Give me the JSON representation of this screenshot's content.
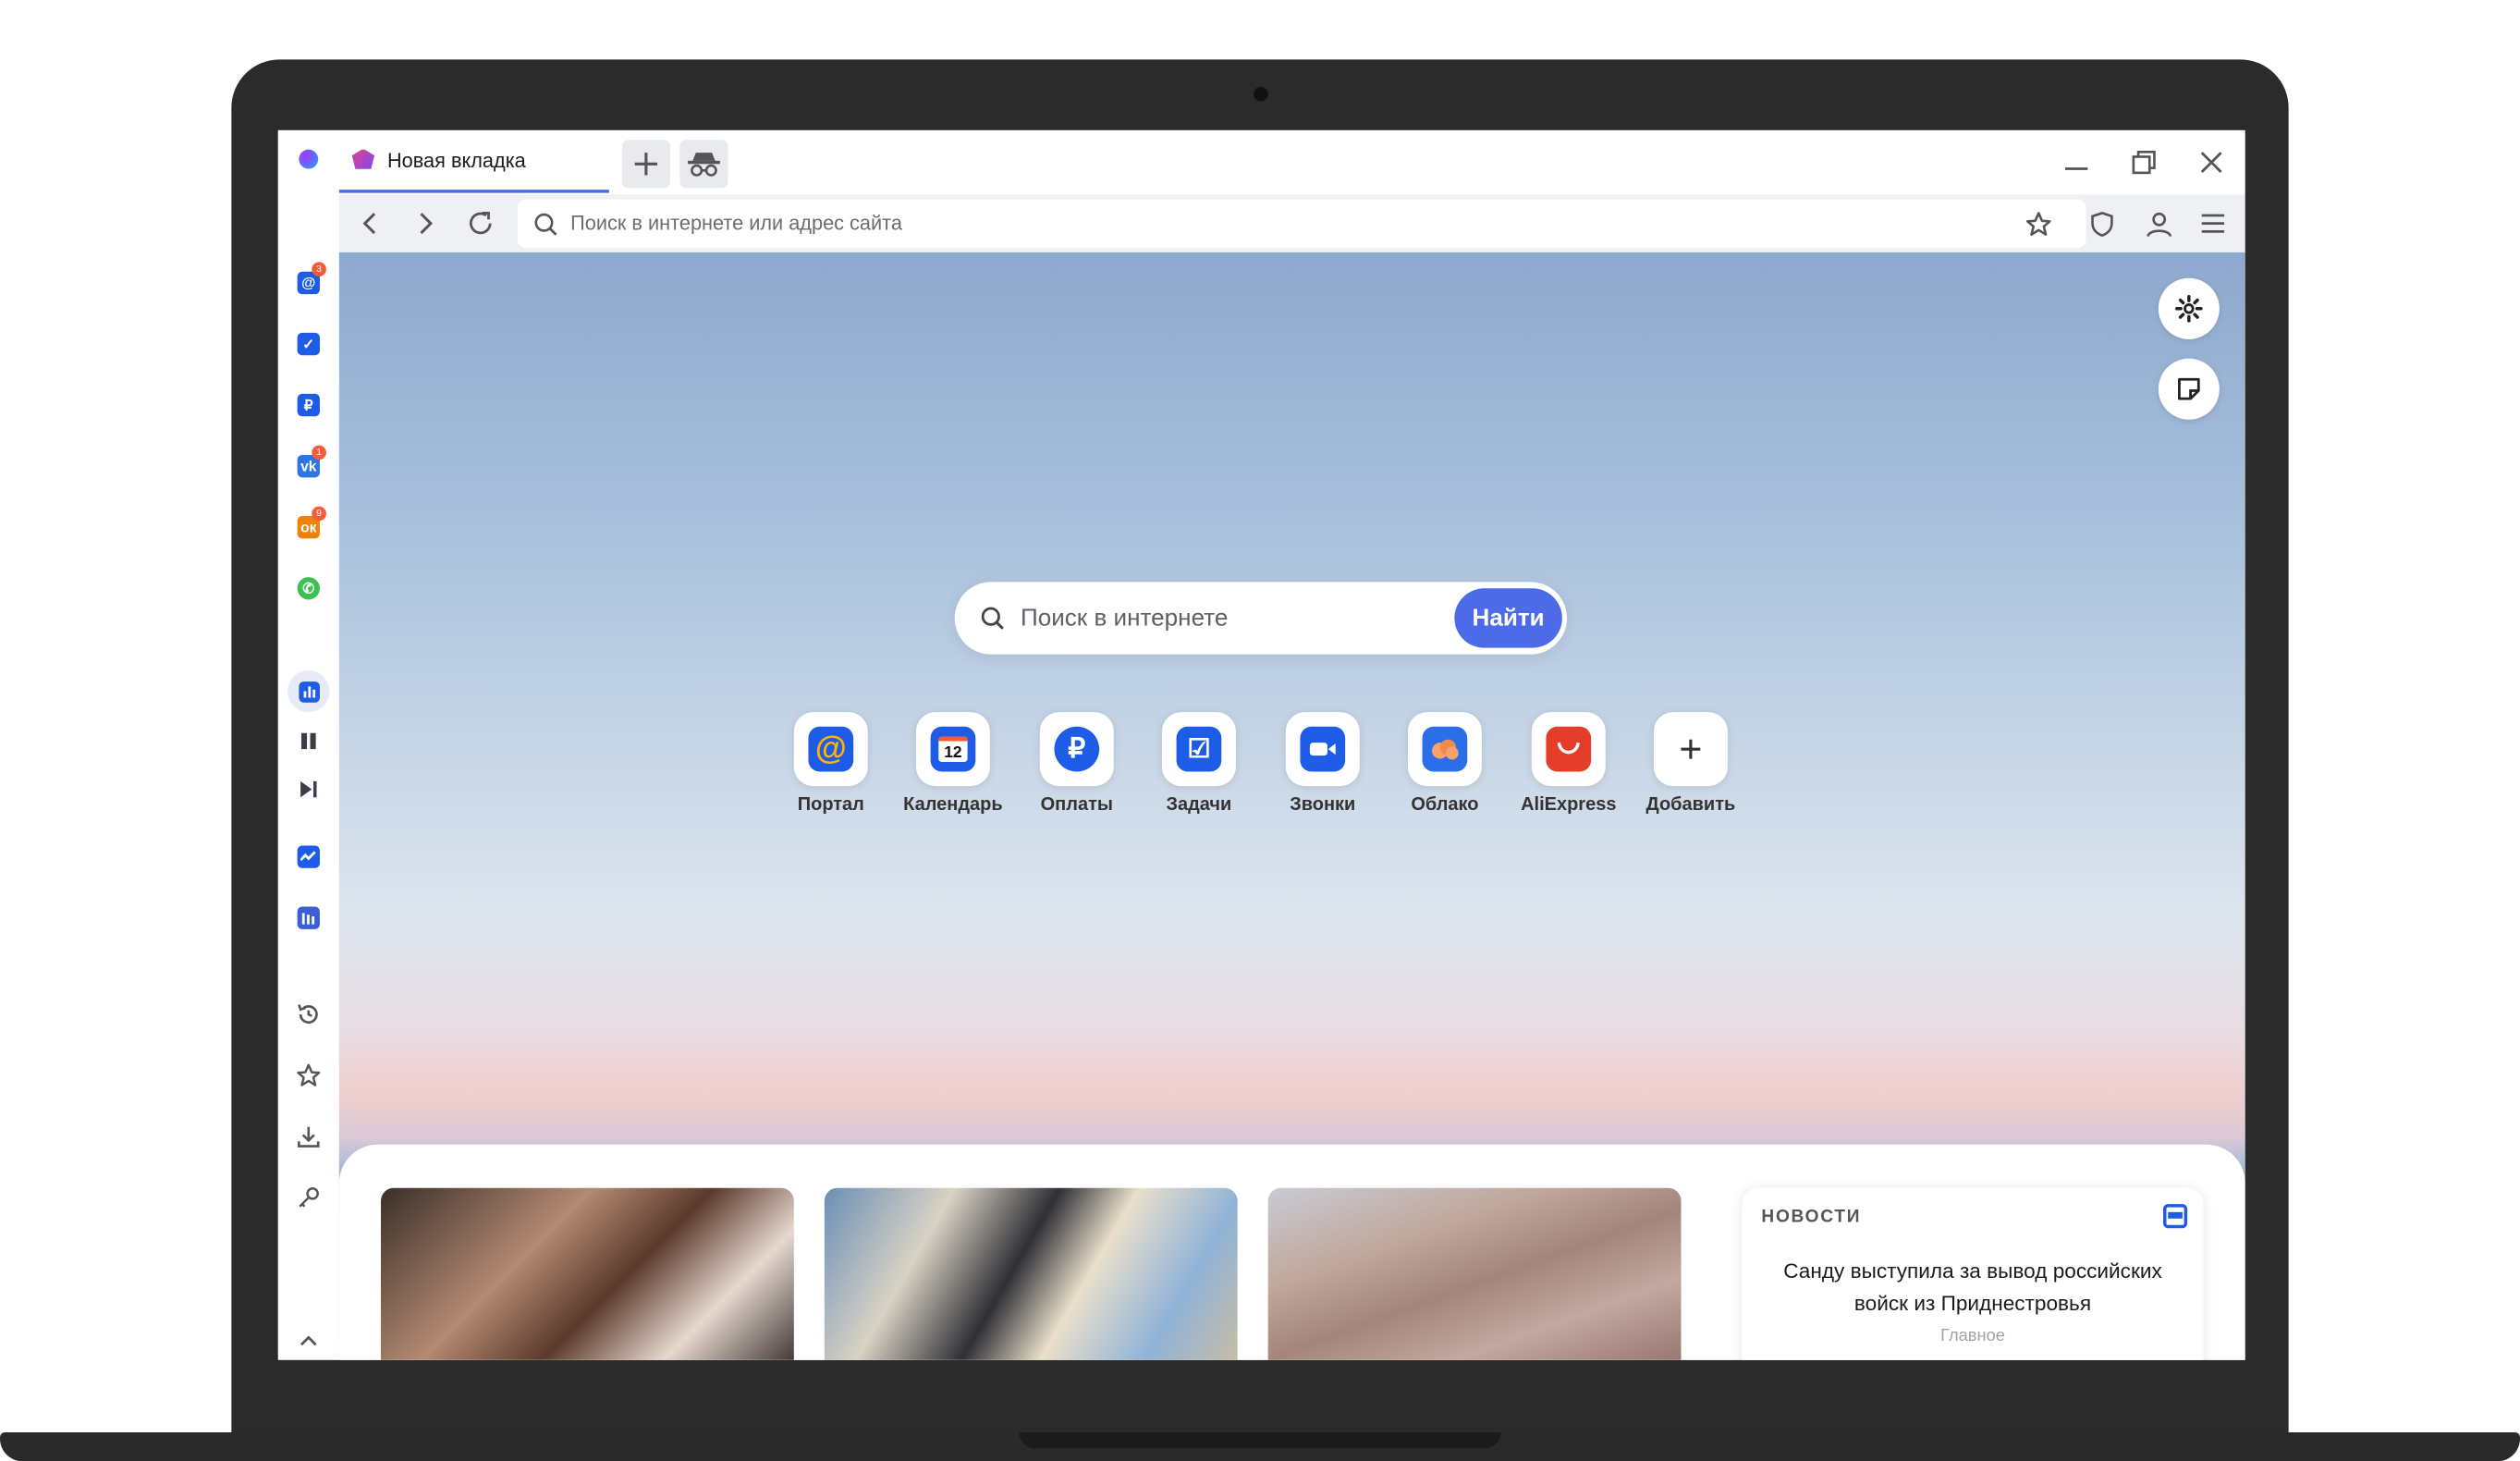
{
  "browser": {
    "tab_title": "Новая вкладка",
    "address_placeholder": "Поиск в интернете или адрес сайта"
  },
  "sidebar": {
    "apps": [
      {
        "name": "mail",
        "badge": "3"
      },
      {
        "name": "tasks",
        "badge": ""
      },
      {
        "name": "payments",
        "badge": ""
      },
      {
        "name": "vk",
        "badge": "1"
      },
      {
        "name": "ok",
        "badge": "9"
      },
      {
        "name": "whatsapp",
        "badge": ""
      }
    ]
  },
  "search": {
    "placeholder": "Поиск в интернете",
    "button": "Найти"
  },
  "shortcuts": [
    {
      "label": "Портал"
    },
    {
      "label": "Календарь",
      "day": "12"
    },
    {
      "label": "Оплаты"
    },
    {
      "label": "Задачи"
    },
    {
      "label": "Звонки"
    },
    {
      "label": "Облако"
    },
    {
      "label": "AliExpress"
    },
    {
      "label": "Добавить"
    }
  ],
  "news": {
    "header": "НОВОСТИ",
    "headline": "Санду выступила за вывод российских войск из Приднестровья",
    "category": "Главное"
  },
  "colors": {
    "accent": "#4d6be8",
    "app_blue": "#1e5be6",
    "badge": "#f25c3b"
  }
}
